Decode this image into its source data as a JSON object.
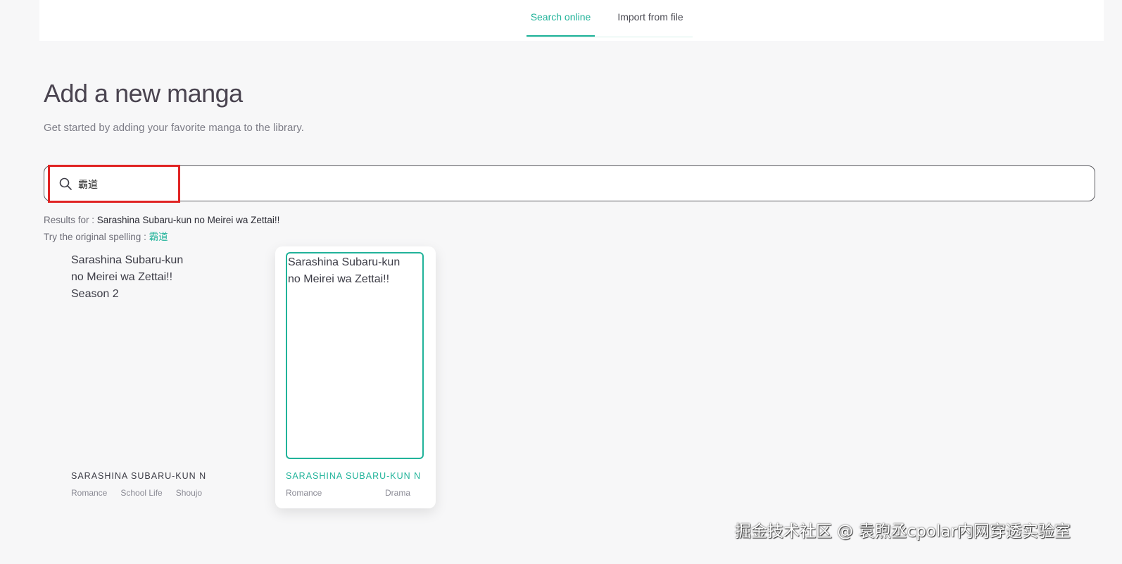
{
  "tabs": [
    {
      "label": "Search online",
      "active": true
    },
    {
      "label": "Import from file",
      "active": false
    }
  ],
  "page": {
    "title": "Add a new manga",
    "subtitle": "Get started by adding your favorite manga to the library."
  },
  "search": {
    "value": "霸道",
    "icon": "search-icon"
  },
  "results": {
    "prefix": "Results for : ",
    "query": "Sarashina Subaru-kun no Meirei wa Zettai!!",
    "try_prefix": "Try the original spelling : ",
    "original": "霸道"
  },
  "cards": [
    {
      "alt_lines": [
        "Sarashina Subaru-kun",
        "no Meirei wa Zettai!!",
        "Season 2"
      ],
      "title": "SARASHINA SUBARU-KUN N",
      "tags": [
        "Romance",
        "School Life",
        "Shoujo"
      ]
    },
    {
      "alt_lines": [
        "Sarashina Subaru-kun",
        "no Meirei wa Zettai!!"
      ],
      "title": "SARASHINA SUBARU-KUN N",
      "tags": [
        "Romance",
        "Drama"
      ]
    }
  ],
  "watermark": "掘金技术社区 @ 袁煦丞cpolar内网穿透实验室",
  "colors": {
    "accent": "#21b39a",
    "highlight": "#e02424"
  }
}
